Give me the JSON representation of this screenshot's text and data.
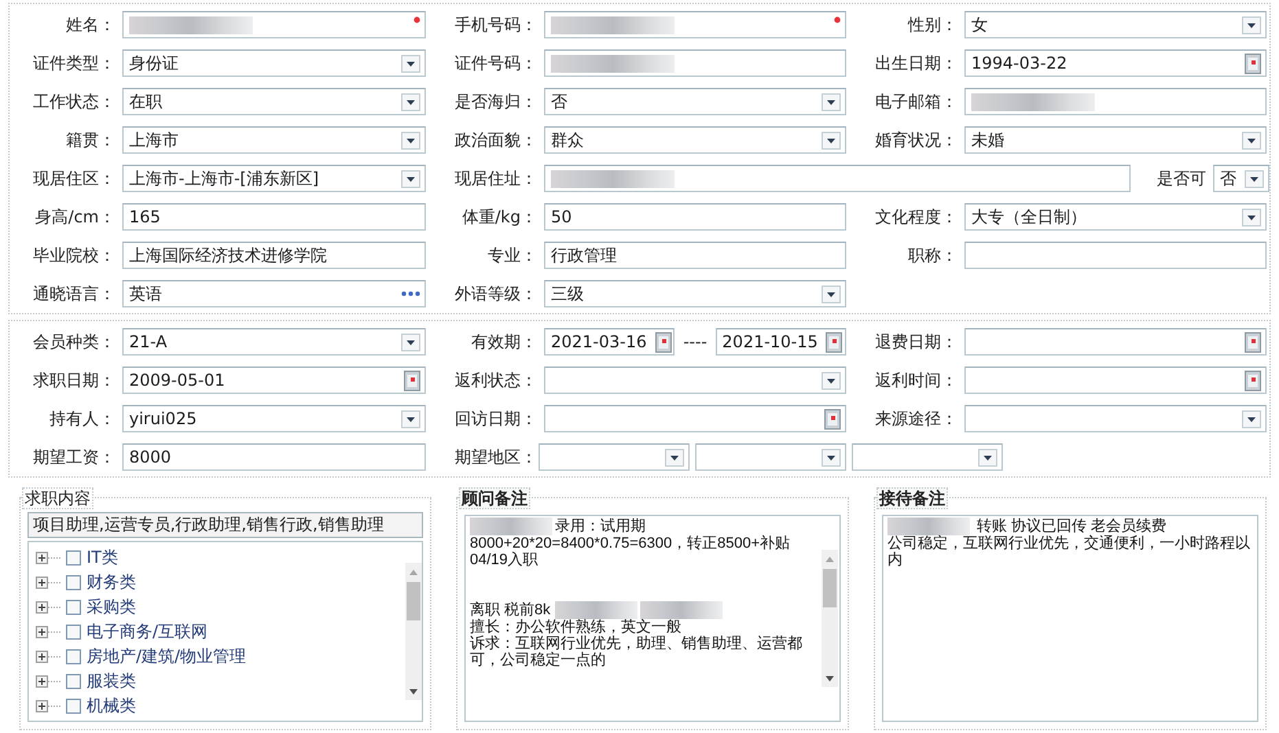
{
  "sections": [
    {
      "rows": [
        {
          "kind": "standard",
          "cells": [
            {
              "label": "姓名：",
              "fields": [
                {
                  "kind": "text",
                  "redacted": true,
                  "required": true
                }
              ]
            },
            {
              "label": "手机号码：",
              "fields": [
                {
                  "kind": "text",
                  "redacted": true,
                  "required": true
                }
              ]
            },
            {
              "label": "性别：",
              "fields": [
                {
                  "kind": "select",
                  "value": "女"
                }
              ]
            }
          ]
        },
        {
          "kind": "standard",
          "cells": [
            {
              "label": "证件类型：",
              "fields": [
                {
                  "kind": "select",
                  "value": "身份证"
                }
              ]
            },
            {
              "label": "证件号码：",
              "fields": [
                {
                  "kind": "text",
                  "redacted": true
                }
              ]
            },
            {
              "label": "出生日期：",
              "fields": [
                {
                  "kind": "date",
                  "value": "1994-03-22"
                }
              ]
            }
          ]
        },
        {
          "kind": "standard",
          "cells": [
            {
              "label": "工作状态：",
              "fields": [
                {
                  "kind": "select",
                  "value": "在职"
                }
              ]
            },
            {
              "label": "是否海归：",
              "fields": [
                {
                  "kind": "select",
                  "value": "否"
                }
              ]
            },
            {
              "label": "电子邮箱：",
              "fields": [
                {
                  "kind": "text",
                  "redacted": true
                }
              ]
            }
          ]
        },
        {
          "kind": "standard",
          "cells": [
            {
              "label": "籍贯：",
              "fields": [
                {
                  "kind": "select",
                  "value": "上海市"
                }
              ]
            },
            {
              "label": "政治面貌：",
              "fields": [
                {
                  "kind": "select",
                  "value": "群众"
                }
              ]
            },
            {
              "label": "婚育状况：",
              "fields": [
                {
                  "kind": "select",
                  "value": "未婚"
                }
              ]
            }
          ]
        },
        {
          "kind": "address",
          "cells": [
            {
              "label": "现居住区：",
              "fields": [
                {
                  "kind": "select",
                  "value": "上海市-上海市-[浦东新区]"
                }
              ]
            },
            {
              "label": "现居住址：",
              "fields": [
                {
                  "kind": "text",
                  "redacted": true
                }
              ]
            },
            {
              "label": "是否可",
              "fields": [
                {
                  "kind": "select",
                  "value": "否"
                }
              ]
            }
          ]
        },
        {
          "kind": "standard",
          "cells": [
            {
              "label": "身高/cm：",
              "fields": [
                {
                  "kind": "text",
                  "value": "165"
                }
              ]
            },
            {
              "label": "体重/kg：",
              "fields": [
                {
                  "kind": "text",
                  "value": "50"
                }
              ]
            },
            {
              "label": "文化程度：",
              "fields": [
                {
                  "kind": "select",
                  "value": "大专（全日制）"
                }
              ]
            }
          ]
        },
        {
          "kind": "standard",
          "cells": [
            {
              "label": "毕业院校：",
              "fields": [
                {
                  "kind": "text",
                  "value": "上海国际经济技术进修学院"
                }
              ]
            },
            {
              "label": "专业：",
              "fields": [
                {
                  "kind": "text",
                  "value": "行政管理"
                }
              ]
            },
            {
              "label": "职称：",
              "fields": [
                {
                  "kind": "text"
                }
              ]
            }
          ]
        },
        {
          "kind": "standard",
          "cells": [
            {
              "label": "通晓语言：",
              "fields": [
                {
                  "kind": "lookup",
                  "value": "英语"
                }
              ]
            },
            {
              "label": "外语等级：",
              "fields": [
                {
                  "kind": "select",
                  "value": "三级"
                }
              ]
            }
          ]
        }
      ]
    },
    {
      "rows": [
        {
          "kind": "range",
          "cells": [
            {
              "label": "会员种类：",
              "fields": [
                {
                  "kind": "select",
                  "value": "21-A"
                }
              ]
            },
            {
              "label": "有效期：",
              "separator": "----",
              "fields": [
                {
                  "kind": "date",
                  "value": "2021-03-16"
                },
                {
                  "kind": "date",
                  "value": "2021-10-15"
                }
              ]
            },
            {
              "label": "退费日期：",
              "fields": [
                {
                  "kind": "date"
                }
              ]
            }
          ]
        },
        {
          "kind": "standard",
          "cells": [
            {
              "label": "求职日期：",
              "fields": [
                {
                  "kind": "date",
                  "value": "2009-05-01"
                }
              ]
            },
            {
              "label": "返利状态：",
              "fields": [
                {
                  "kind": "select"
                }
              ]
            },
            {
              "label": "返利时间：",
              "fields": [
                {
                  "kind": "date"
                }
              ]
            }
          ]
        },
        {
          "kind": "standard",
          "cells": [
            {
              "label": "持有人：",
              "fields": [
                {
                  "kind": "select",
                  "value": "yirui025"
                }
              ]
            },
            {
              "label": "回访日期：",
              "fields": [
                {
                  "kind": "date"
                }
              ]
            },
            {
              "label": "来源途径：",
              "fields": [
                {
                  "kind": "select"
                }
              ]
            }
          ]
        },
        {
          "kind": "regions",
          "cells": [
            {
              "label": "期望工资：",
              "fields": [
                {
                  "kind": "text",
                  "value": "8000"
                }
              ]
            },
            {
              "label": "期望地区：",
              "fields": [
                {
                  "kind": "select"
                },
                {
                  "kind": "select"
                },
                {
                  "kind": "select"
                }
              ]
            }
          ]
        }
      ]
    }
  ],
  "job_content": {
    "title": "求职内容",
    "value": "项目助理,运营专员,行政助理,销售行政,销售助理",
    "scrollable": true,
    "tree": [
      {
        "label": "IT类",
        "checked": false,
        "expanded": false
      },
      {
        "label": "财务类",
        "checked": false,
        "expanded": false
      },
      {
        "label": "采购类",
        "checked": false,
        "expanded": false
      },
      {
        "label": "电子商务/互联网",
        "checked": false,
        "expanded": false
      },
      {
        "label": "房地产/建筑/物业管理",
        "checked": false,
        "expanded": false
      },
      {
        "label": "服装类",
        "checked": false,
        "expanded": false
      },
      {
        "label": "机械类",
        "checked": false,
        "expanded": false
      }
    ]
  },
  "notes": [
    {
      "title": "顾问备注",
      "scrollable": true,
      "paragraphs": [
        {
          "kind": "line",
          "parts": [
            {
              "kind": "redacted"
            },
            {
              "kind": "text",
              "text": "录用：试用期"
            }
          ]
        },
        {
          "kind": "line",
          "parts": [
            {
              "kind": "text",
              "text": "8000+20*20=8400*0.75=6300，转正8500+补贴"
            }
          ]
        },
        {
          "kind": "line",
          "parts": [
            {
              "kind": "text",
              "text": "04/19入职"
            }
          ]
        },
        {
          "kind": "blank"
        },
        {
          "kind": "blank"
        },
        {
          "kind": "line",
          "parts": [
            {
              "kind": "text",
              "text": "离职 税前8k "
            },
            {
              "kind": "redacted"
            },
            {
              "kind": "redacted"
            }
          ]
        },
        {
          "kind": "line",
          "parts": [
            {
              "kind": "text",
              "text": "擅长：办公软件熟练，英文一般"
            }
          ]
        },
        {
          "kind": "line",
          "parts": [
            {
              "kind": "text",
              "text": "诉求：互联网行业优先，助理、销售助理、运营都可，公司稳定一点的"
            }
          ]
        }
      ]
    },
    {
      "title": "接待备注",
      "scrollable": false,
      "paragraphs": [
        {
          "kind": "line",
          "parts": [
            {
              "kind": "redacted"
            },
            {
              "kind": "text",
              "text": " 转账 协议已回传 老会员续费"
            }
          ]
        },
        {
          "kind": "line",
          "parts": [
            {
              "kind": "text",
              "text": "公司稳定，互联网行业优先，交通便利，一小时路程以内"
            }
          ]
        }
      ]
    }
  ]
}
